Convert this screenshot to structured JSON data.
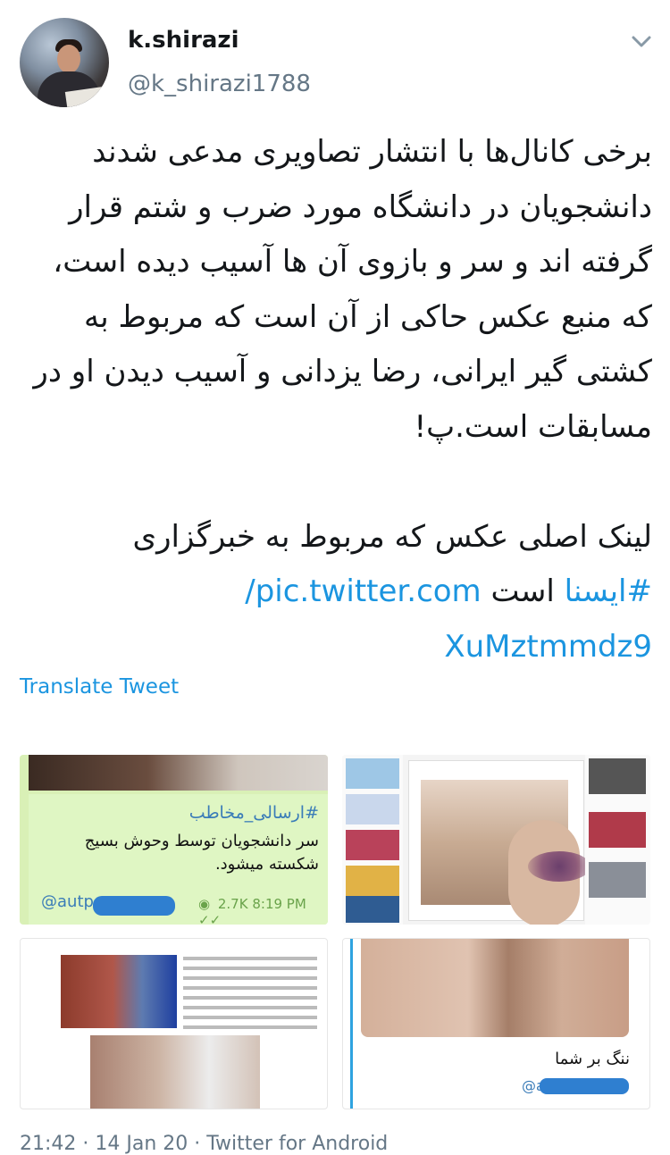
{
  "user": {
    "name": "k.shirazi",
    "handle": "@k_shirazi1788",
    "avatar_icon": "profile-photo"
  },
  "tweet": {
    "paragraph1": "برخی کانال‌ها با انتشار تصاویری مدعی شدند دانشجویان در دانشگاه مورد ضرب و شتم قرار گرفته اند و سر و بازوی آن ها آسیب دیده است، که منبع عکس حاکی از آن است که مربوط به کشتی گیر ایرانی، رضا یزدانی و آسیب دیدن او در مسابقات است.پ!",
    "paragraph2_text": "لینک اصلی عکس که مربوط به خبرگزاری",
    "hashtag": "#ایسنا",
    "word_is": "است",
    "link_part1": "pic.twitter.com/",
    "link_part2": "XuMztmmdz9"
  },
  "actions": {
    "translate": "Translate Tweet"
  },
  "media": {
    "m1": {
      "forwarded_label": "#ارسالی_مخاطب",
      "message": "سر دانشجویان توسط وحوش بسیج شکسته میشود.",
      "sender": "@autp",
      "views": "2.7K",
      "time": "8:19 PM"
    },
    "m4": {
      "text": "ننگ بر شما",
      "sender": "@a"
    }
  },
  "footer": {
    "text": "21:42 · 14 Jan 20 · Twitter for Android"
  },
  "colors": {
    "accent": "#1b95e0",
    "muted": "#657786"
  }
}
